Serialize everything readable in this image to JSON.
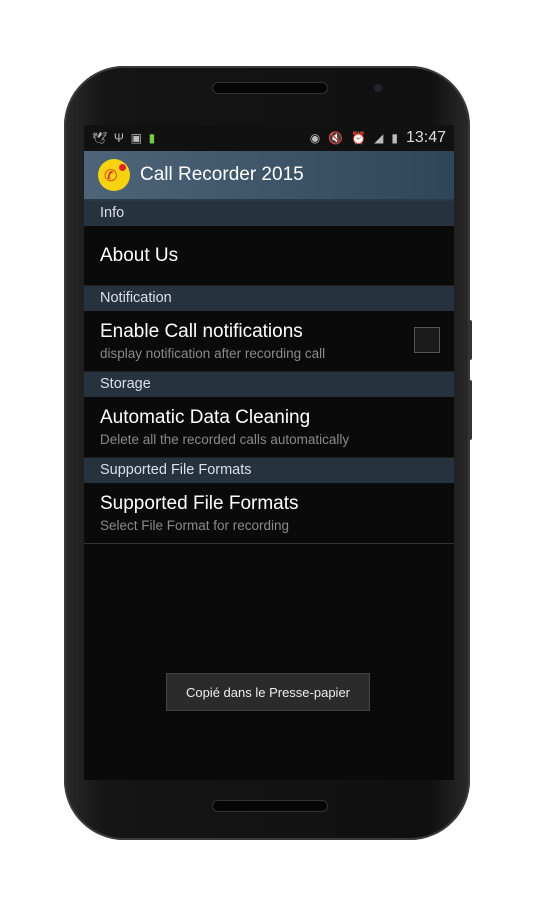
{
  "status": {
    "time": "13:47",
    "left_icons": [
      "bird-icon",
      "usb-icon",
      "image-icon",
      "battery-app-icon"
    ],
    "right_icons": [
      "eye-icon",
      "mute-icon",
      "alarm-icon",
      "signal-icon",
      "battery-charging-icon"
    ]
  },
  "app": {
    "title": "Call Recorder 2015",
    "logo_text": "REC"
  },
  "sections": [
    {
      "header": "Info",
      "items": [
        {
          "title": "About Us"
        }
      ]
    },
    {
      "header": "Notification",
      "items": [
        {
          "title": "Enable Call notifications",
          "summary": "display notification after recording call",
          "checked": false
        }
      ]
    },
    {
      "header": "Storage",
      "items": [
        {
          "title": "Automatic Data Cleaning",
          "summary": "Delete all the recorded calls automatically"
        }
      ]
    },
    {
      "header": "Supported File Formats",
      "items": [
        {
          "title": "Supported File Formats",
          "summary": "Select File Format for recording"
        }
      ]
    }
  ],
  "toast": "Copié dans le Presse-papier"
}
